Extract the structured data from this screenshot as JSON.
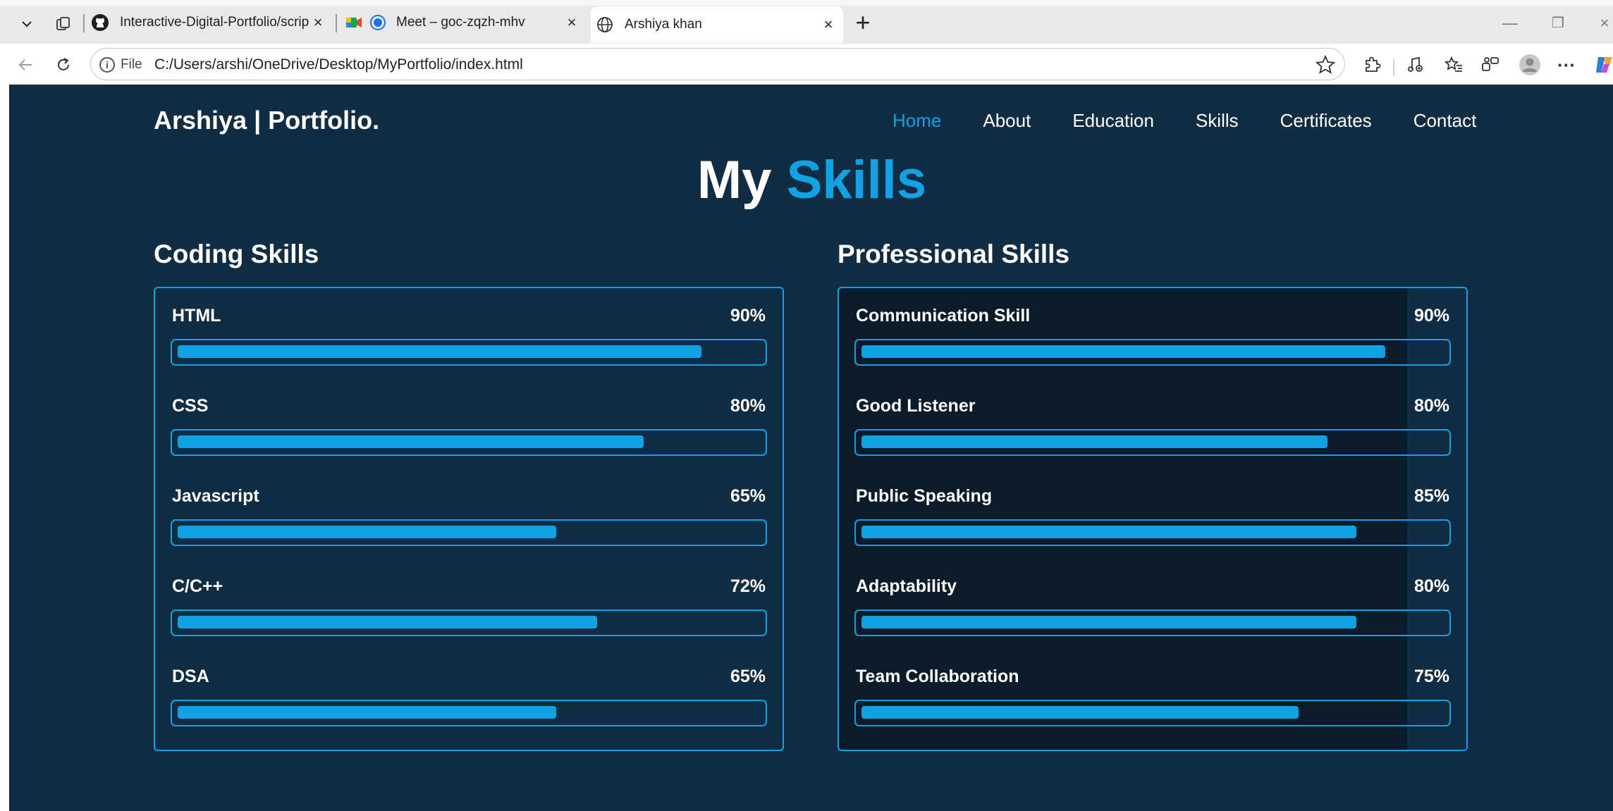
{
  "browser": {
    "tabs": [
      {
        "title": "Interactive-Digital-Portfolio/script",
        "icon": "github-icon"
      },
      {
        "title": "Meet – goc-zqzh-mhv",
        "icon": "google-meet-icon"
      },
      {
        "title": "Arshiya khan",
        "icon": "globe-icon"
      }
    ],
    "address": {
      "scheme": "File",
      "url": "C:/Users/arshi/OneDrive/Desktop/MyPortfolio/index.html"
    }
  },
  "site": {
    "logo": "Arshiya | Portfolio.",
    "nav": [
      "Home",
      "About",
      "Education",
      "Skills",
      "Certificates",
      "Contact"
    ],
    "active_nav": "Home",
    "heading_plain": "My",
    "heading_accent": "Skills",
    "accent_color": "#0fa3e6",
    "background_color": "#112d43"
  },
  "coding": {
    "title": "Coding Skills",
    "skills": [
      {
        "name": "HTML",
        "percent_label": "90%",
        "level": 0.9
      },
      {
        "name": "CSS",
        "percent_label": "80%",
        "level": 0.8
      },
      {
        "name": "Javascript",
        "percent_label": "65%",
        "level": 0.65
      },
      {
        "name": "C/C++",
        "percent_label": "72%",
        "level": 0.72
      },
      {
        "name": "DSA",
        "percent_label": "65%",
        "level": 0.65
      }
    ]
  },
  "professional": {
    "title": "Professional Skills",
    "skills": [
      {
        "name": "Communication Skill",
        "percent_label": "90%",
        "level": 0.9
      },
      {
        "name": "Good Listener",
        "percent_label": "80%",
        "level": 0.8
      },
      {
        "name": "Public Speaking",
        "percent_label": "85%",
        "level": 0.85
      },
      {
        "name": "Adaptability",
        "percent_label": "80%",
        "level": 0.85
      },
      {
        "name": "Team Collaboration",
        "percent_label": "75%",
        "level": 0.75
      }
    ]
  }
}
